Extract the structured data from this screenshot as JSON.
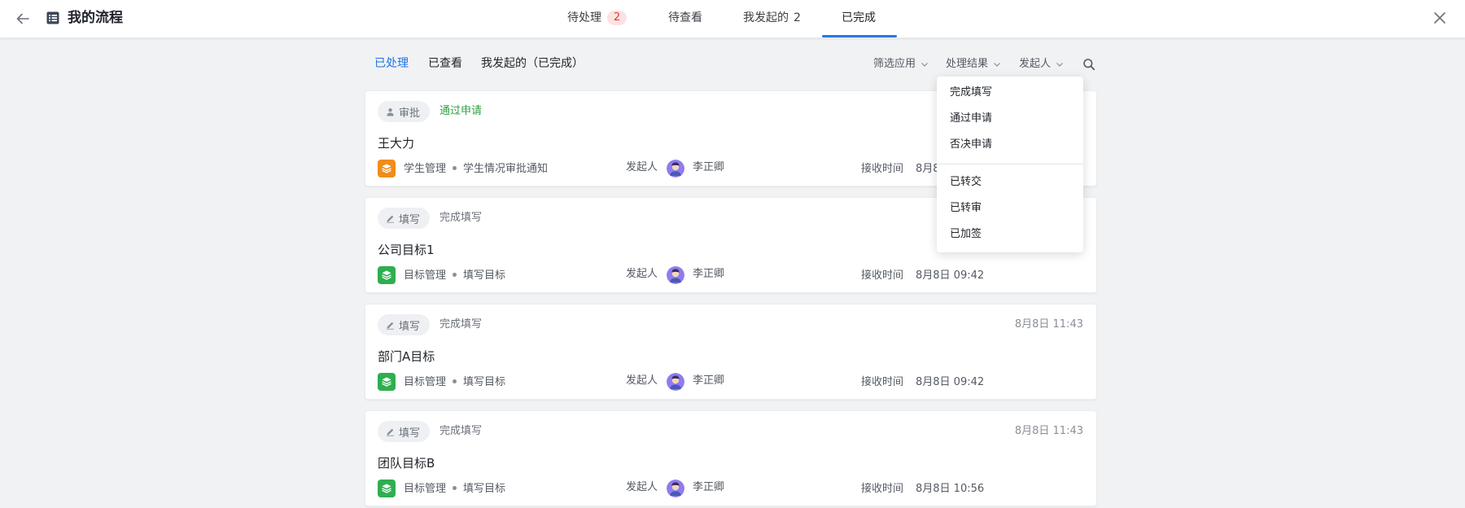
{
  "header": {
    "title": "我的流程",
    "tabs": [
      {
        "label": "待处理",
        "badge": "2"
      },
      {
        "label": "待查看"
      },
      {
        "label": "我发起的",
        "count": "2"
      },
      {
        "label": "已完成"
      }
    ]
  },
  "subtabs": [
    "已处理",
    "已查看",
    "我发起的（已完成）"
  ],
  "filters": [
    "筛选应用",
    "处理结果",
    "发起人"
  ],
  "dropdown": {
    "items": [
      "完成填写",
      "通过申请",
      "否决申请",
      "已转交",
      "已转审",
      "已加签"
    ]
  },
  "card_labels": {
    "initiator": "发起人",
    "received": "接收时间"
  },
  "cards": [
    {
      "tag": "审批",
      "status": "通过申请",
      "time": "",
      "title": "王大力",
      "module": "学生管理",
      "form": "学生情况审批通知",
      "initiator": "李正卿",
      "received": "8月8"
    },
    {
      "tag": "填写",
      "status": "完成填写",
      "time": "",
      "title": "公司目标1",
      "module": "目标管理",
      "form": "填写目标",
      "initiator": "李正卿",
      "received": "8月8日 09:42"
    },
    {
      "tag": "填写",
      "status": "完成填写",
      "time": "8月8日 11:43",
      "title": "部门A目标",
      "module": "目标管理",
      "form": "填写目标",
      "initiator": "李正卿",
      "received": "8月8日 09:42"
    },
    {
      "tag": "填写",
      "status": "完成填写",
      "time": "8月8日 11:43",
      "title": "团队目标B",
      "module": "目标管理",
      "form": "填写目标",
      "initiator": "李正卿",
      "received": "8月8日 10:56"
    }
  ],
  "colors": {
    "accent": "#1a73e8",
    "approve_green": "#2ea043",
    "badge_red": "#e53935",
    "student_module": "#f08c1a",
    "goal_module": "#2fae4f"
  }
}
